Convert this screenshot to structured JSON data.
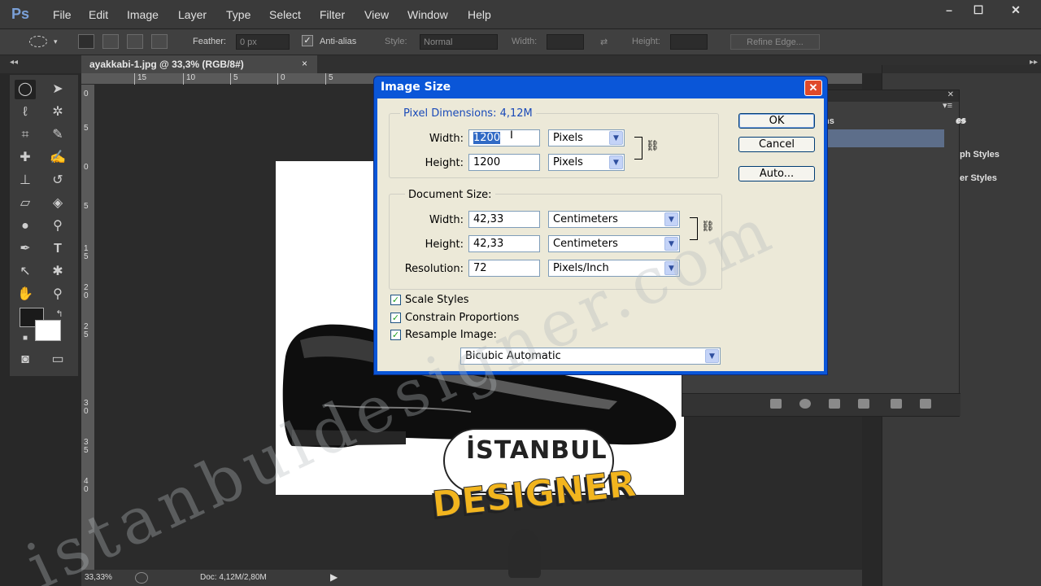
{
  "app": {
    "logo": "Ps",
    "menu": [
      "File",
      "Edit",
      "Image",
      "Layer",
      "Type",
      "Select",
      "Filter",
      "View",
      "Window",
      "Help"
    ],
    "window_controls": [
      "–",
      "☐",
      "✕"
    ]
  },
  "options_bar": {
    "feather_label": "Feather:",
    "feather_value": "0 px",
    "antialias_label": "Anti-alias",
    "style_label": "Style:",
    "style_value": "Normal",
    "width_label": "Width:",
    "height_label": "Height:",
    "refine_edge": "Refine Edge..."
  },
  "document": {
    "tab_title": "ayakkabi-1.jpg @ 33,3% (RGB/8#)",
    "tab_close": "×",
    "ruler_top": [
      "15",
      "10",
      "5",
      "0",
      "5"
    ],
    "ruler_left": [
      "0",
      "5",
      "0",
      "5",
      "1",
      "5",
      "2",
      "0",
      "2",
      "5",
      "3",
      "0",
      "3",
      "5",
      "4",
      "0"
    ],
    "zoom": "33,33%",
    "doc_info": "Doc: 4,12M/2,80M"
  },
  "panels": {
    "items": [
      "ns",
      "es",
      "ph Styles",
      "er Styles"
    ]
  },
  "dialog": {
    "title": "Image Size",
    "close": "✕",
    "pixel_dimensions_label": "Pixel Dimensions:",
    "pixel_dimensions_value": "4,12M",
    "px_width_label": "Width:",
    "px_width_value": "1200",
    "px_width_unit": "Pixels",
    "px_height_label": "Height:",
    "px_height_value": "1200",
    "px_height_unit": "Pixels",
    "document_size_label": "Document Size:",
    "doc_width_label": "Width:",
    "doc_width_value": "42,33",
    "doc_width_unit": "Centimeters",
    "doc_height_label": "Height:",
    "doc_height_value": "42,33",
    "doc_height_unit": "Centimeters",
    "resolution_label": "Resolution:",
    "resolution_value": "72",
    "resolution_unit": "Pixels/Inch",
    "scale_styles": "Scale Styles",
    "constrain_proportions": "Constrain Proportions",
    "resample_image": "Resample Image:",
    "resample_method": "Bicubic Automatic",
    "ok": "OK",
    "cancel": "Cancel",
    "auto": "Auto..."
  },
  "watermark": "istanbuldesigner.com",
  "logo": {
    "line1": "İSTANBUL",
    "line2": "DESIGNER"
  }
}
